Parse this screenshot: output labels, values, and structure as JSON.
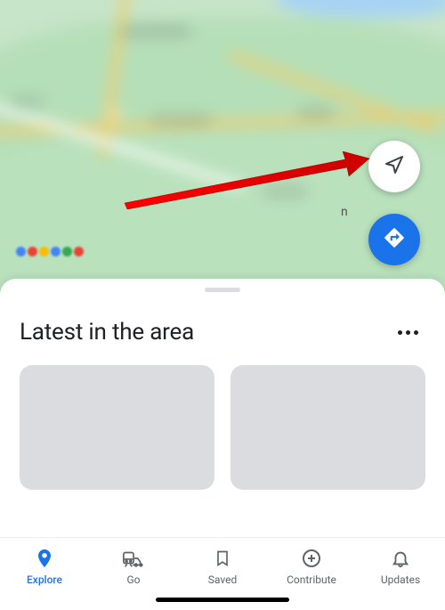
{
  "section": {
    "title": "Latest in the area"
  },
  "nav": {
    "items": [
      {
        "label": "Explore",
        "active": true
      },
      {
        "label": "Go",
        "active": false
      },
      {
        "label": "Saved",
        "active": false
      },
      {
        "label": "Contribute",
        "active": false
      },
      {
        "label": "Updates",
        "active": false
      }
    ]
  },
  "map": {
    "visible_letter": "n"
  },
  "colors": {
    "accent": "#1a73e8",
    "arrow": "#e60000"
  }
}
